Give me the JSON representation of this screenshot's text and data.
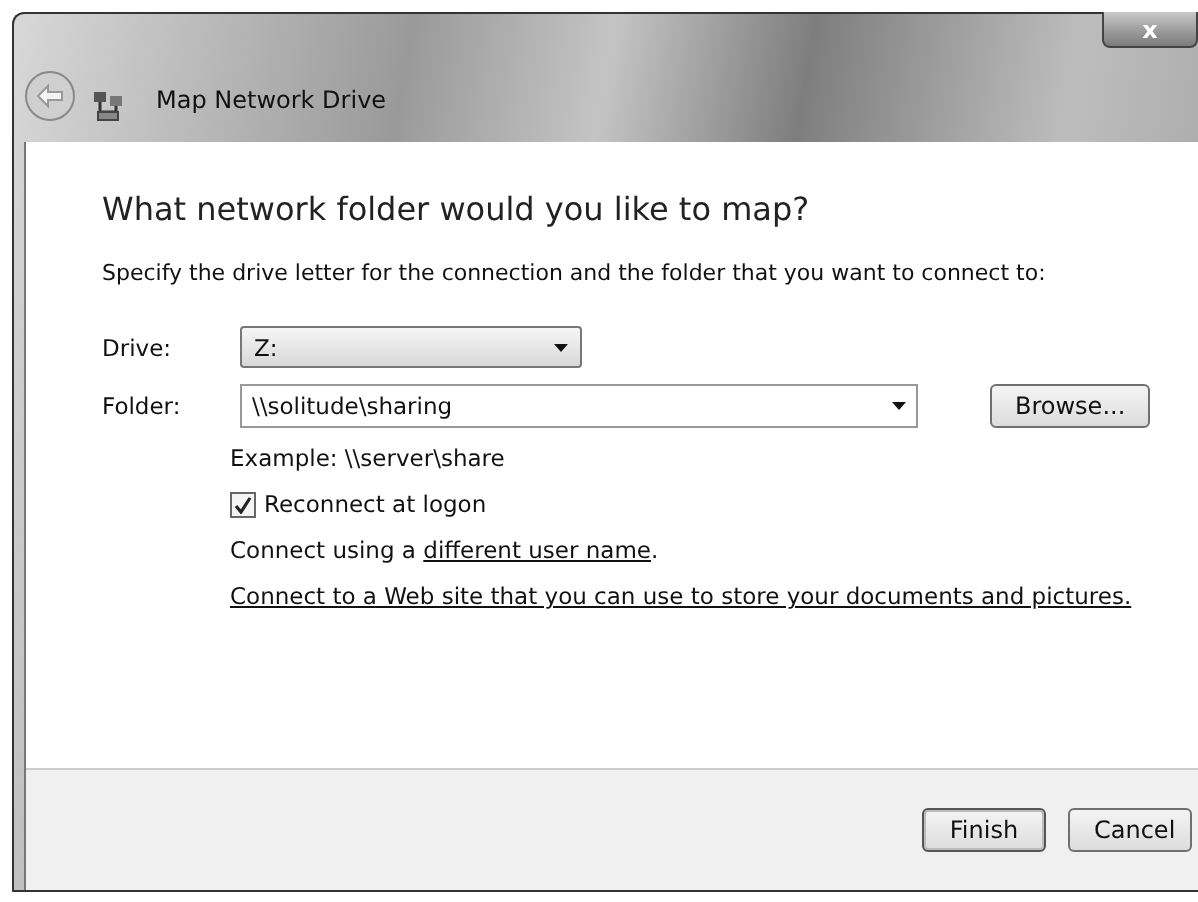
{
  "window": {
    "title": "Map Network Drive",
    "close_label": "x"
  },
  "heading": "What network folder would you like to map?",
  "instruction": "Specify the drive letter for the connection and the folder that you want to connect to:",
  "drive": {
    "label": "Drive:",
    "value": "Z:"
  },
  "folder": {
    "label": "Folder:",
    "value": "\\\\solitude\\sharing",
    "browse": "Browse..."
  },
  "example": "Example: \\\\server\\share",
  "reconnect": {
    "label": "Reconnect at logon",
    "checked": true
  },
  "credentials": {
    "before": "Connect using a ",
    "link": "different user name",
    "after": "."
  },
  "web_link": "Connect to a Web site that you can use to store your documents and pictures.",
  "buttons": [
    {
      "label": "Finish",
      "kind": "default"
    },
    {
      "label": "Cancel",
      "kind": "normal"
    }
  ]
}
